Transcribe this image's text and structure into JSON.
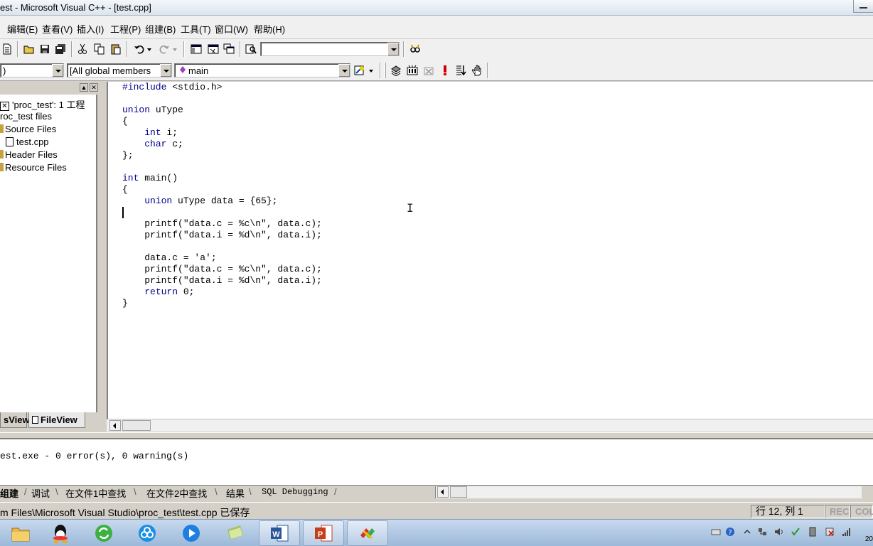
{
  "window": {
    "title": "est - Microsoft Visual C++ - [test.cpp]"
  },
  "menu": [
    "编辑(E)",
    "查看(V)",
    "插入(I)",
    "工程(P)",
    "组建(B)",
    "工具(T)",
    "窗口(W)",
    "帮助(H)"
  ],
  "toolbar2": {
    "class_combo": ")",
    "members_combo": "[All global members",
    "function_combo": "main"
  },
  "workspace": {
    "tree": [
      "'proc_test': 1 工程",
      "roc_test files",
      "Source Files",
      "test.cpp",
      "Header Files",
      "Resource Files"
    ],
    "tabs": [
      "sView",
      "FileView"
    ]
  },
  "editor": {
    "lines": [
      "#include <stdio.h>",
      "",
      "union uType",
      "{",
      "    int i;",
      "    char c;",
      "};",
      "",
      "int main()",
      "{",
      "    union uType data = {65};",
      "",
      "    printf(\"data.c = %c\\n\", data.c);",
      "    printf(\"data.i = %d\\n\", data.i);",
      "",
      "    data.c = 'a';",
      "    printf(\"data.c = %c\\n\", data.c);",
      "    printf(\"data.i = %d\\n\", data.i);",
      "    return 0;",
      "}"
    ]
  },
  "output": {
    "text": "est.exe - 0 error(s), 0 warning(s)"
  },
  "output_tabs": [
    "组建",
    "调试",
    "在文件1中查找",
    "在文件2中查找",
    "结果",
    "SQL Debugging"
  ],
  "status": {
    "message": "m Files\\Microsoft Visual Studio\\proc_test\\test.cpp 已保存",
    "position": "行 12, 列 1",
    "rec": "REC",
    "col": "COL"
  },
  "taskbar": {
    "apps": [
      "file-explorer-icon",
      "qq-icon",
      "refresh-app-icon",
      "cloud-icon",
      "media-player-icon",
      "notes-icon",
      "word-icon",
      "powerpoint-icon",
      "visual-cpp-icon"
    ],
    "clock": "20"
  }
}
